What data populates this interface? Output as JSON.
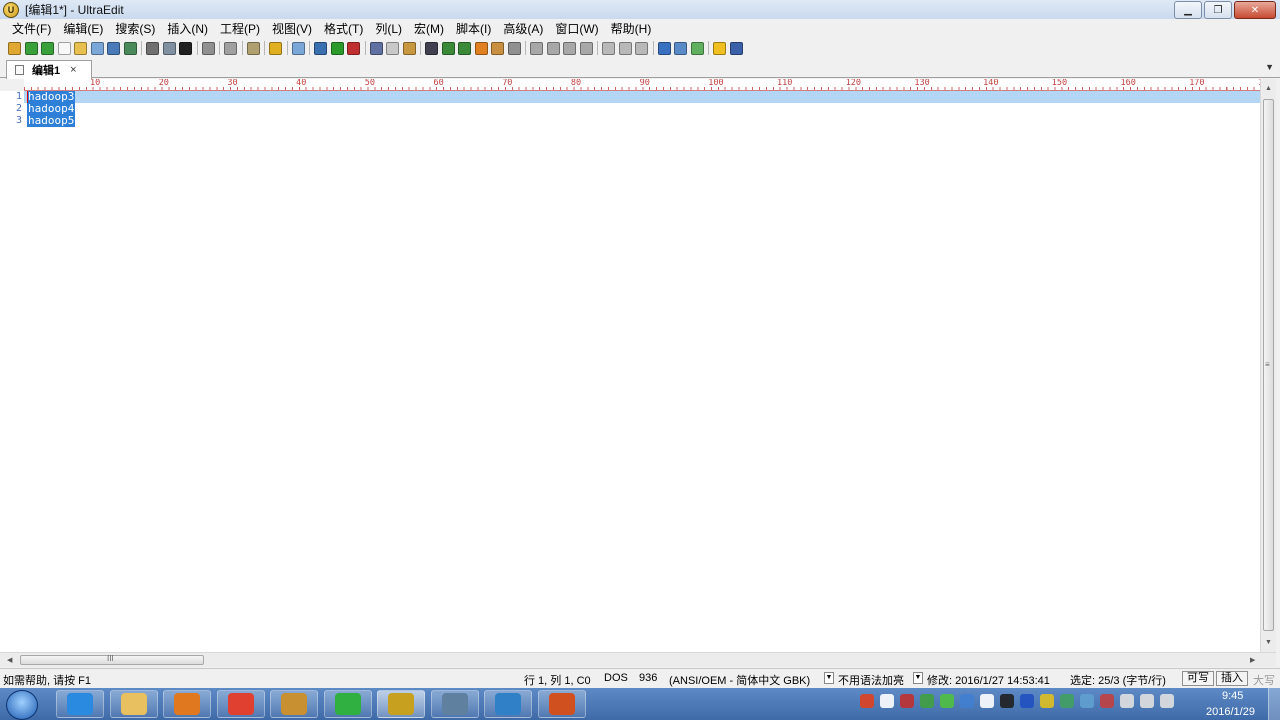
{
  "window": {
    "title": "[编辑1*] - UltraEdit",
    "min_glyph": "▁",
    "max_glyph": "❐",
    "close_glyph": "✕"
  },
  "menu": [
    "文件(F)",
    "编辑(E)",
    "搜索(S)",
    "插入(N)",
    "工程(P)",
    "视图(V)",
    "格式(T)",
    "列(L)",
    "宏(M)",
    "脚本(I)",
    "高级(A)",
    "窗口(W)",
    "帮助(H)"
  ],
  "toolbar": {
    "icons": [
      {
        "name": "new-project-icon",
        "color": "#e0a830"
      },
      {
        "name": "back-icon",
        "color": "#3aa03a"
      },
      {
        "name": "forward-icon",
        "color": "#3aa03a"
      },
      {
        "name": "new-file-icon",
        "color": "#f8f8f8"
      },
      {
        "name": "open-file-icon",
        "color": "#e8c050"
      },
      {
        "name": "close-file-icon",
        "color": "#7aa6d8"
      },
      {
        "name": "save-icon",
        "color": "#4a7bb8"
      },
      {
        "name": "save-all-icon",
        "color": "#4a8a5a"
      },
      {
        "name": "sep"
      },
      {
        "name": "print-icon",
        "color": "#707070"
      },
      {
        "name": "print-preview-icon",
        "color": "#8090a0"
      },
      {
        "name": "font-icon",
        "color": "#202020"
      },
      {
        "name": "sep"
      },
      {
        "name": "word-wrap-icon",
        "color": "#909090"
      },
      {
        "name": "sep"
      },
      {
        "name": "line-number-icon",
        "color": "#a0a0a0"
      },
      {
        "name": "sep"
      },
      {
        "name": "hex-icon",
        "color": "#b0a070"
      },
      {
        "name": "sep"
      },
      {
        "name": "column-icon",
        "color": "#e0b020"
      },
      {
        "name": "sep"
      },
      {
        "name": "spell-check-icon",
        "color": "#7aa6d8"
      },
      {
        "name": "sep"
      },
      {
        "name": "record-macro-icon",
        "color": "#3a6fb0"
      },
      {
        "name": "play-macro-icon",
        "color": "#2a9a2a"
      },
      {
        "name": "stop-macro-icon",
        "color": "#c03030"
      },
      {
        "name": "sep"
      },
      {
        "name": "cut-icon",
        "color": "#6070a0"
      },
      {
        "name": "copy-icon",
        "color": "#c8c8c8"
      },
      {
        "name": "paste-icon",
        "color": "#c89840"
      },
      {
        "name": "sep"
      },
      {
        "name": "find-icon",
        "color": "#404050"
      },
      {
        "name": "find-next-icon",
        "color": "#3a8a3a"
      },
      {
        "name": "find-prev-icon",
        "color": "#3a8a3a"
      },
      {
        "name": "replace-icon",
        "color": "#e08020"
      },
      {
        "name": "find-in-files-icon",
        "color": "#c89040"
      },
      {
        "name": "replace-in-files-icon",
        "color": "#909090"
      },
      {
        "name": "sep"
      },
      {
        "name": "align-left-icon",
        "color": "#a8a8a8"
      },
      {
        "name": "align-center-icon",
        "color": "#a8a8a8"
      },
      {
        "name": "align-right-icon",
        "color": "#a8a8a8"
      },
      {
        "name": "justify-icon",
        "color": "#a8a8a8"
      },
      {
        "name": "sep"
      },
      {
        "name": "split-horizontal-icon",
        "color": "#b8b8b8"
      },
      {
        "name": "split-vertical-icon",
        "color": "#b8b8b8"
      },
      {
        "name": "window-list-icon",
        "color": "#b8b8b8"
      },
      {
        "name": "sep"
      },
      {
        "name": "web-browser-icon",
        "color": "#3a70c0"
      },
      {
        "name": "ftp-icon",
        "color": "#5a8ac8"
      },
      {
        "name": "compare-icon",
        "color": "#60b060"
      },
      {
        "name": "sep"
      },
      {
        "name": "tip-icon",
        "color": "#f0c020"
      },
      {
        "name": "help-icon",
        "color": "#3a60a8"
      }
    ]
  },
  "tab": {
    "label": "编辑1",
    "close_glyph": "×",
    "menu_glyph": "▼"
  },
  "ruler": {
    "labels": [
      "10",
      "20",
      "30",
      "40",
      "50",
      "60",
      "70",
      "80",
      "90",
      "100",
      "110",
      "120",
      "130",
      "140",
      "150",
      "160",
      "170",
      "1"
    ]
  },
  "editor": {
    "lines": [
      {
        "no": "1",
        "text": "hadoop3"
      },
      {
        "no": "2",
        "text": "hadoop4"
      },
      {
        "no": "3",
        "text": "hadoop5"
      }
    ]
  },
  "scroll": {
    "up": "▲",
    "down": "▼",
    "left": "◀",
    "right": "▶",
    "grip": "≡",
    "hgrip": "III"
  },
  "status": {
    "help": "如需帮助, 请按 F1",
    "position": "行 1, 列 1, C0",
    "line_ending": "DOS",
    "codepage": "936",
    "encoding": "(ANSI/OEM - 简体中文 GBK)",
    "dropdown_glyph": "▼",
    "highlight": "不用语法加亮",
    "modified": "修改: 2016/1/27 14:53:41",
    "selection": "选定: 25/3 (字节/行)",
    "writable": "可写",
    "insert_mode": "插入",
    "caps": "大写"
  },
  "taskbar": {
    "apps": [
      {
        "name": "ie-icon",
        "color": "#2a8ae0"
      },
      {
        "name": "explorer-icon",
        "color": "#e8c060"
      },
      {
        "name": "media-player-icon",
        "color": "#e07820"
      },
      {
        "name": "chrome-icon",
        "color": "#e04030"
      },
      {
        "name": "installer-icon",
        "color": "#c89030"
      },
      {
        "name": "360-browser-icon",
        "color": "#30b040"
      },
      {
        "name": "ultraedit-icon",
        "color": "#c8a020"
      },
      {
        "name": "printer-icon",
        "color": "#6080a0"
      },
      {
        "name": "vmware-icon",
        "color": "#3080c8"
      },
      {
        "name": "game-icon",
        "color": "#d05020"
      }
    ],
    "tray": [
      {
        "name": "sogou-icon",
        "color": "#e04020"
      },
      {
        "name": "ime-icon",
        "color": "#ffffff"
      },
      {
        "name": "tray-app-icon",
        "color": "#c03030"
      },
      {
        "name": "network-icon",
        "color": "#40a040"
      },
      {
        "name": "wechat-icon",
        "color": "#50c040"
      },
      {
        "name": "shield-icon",
        "color": "#4080d0"
      },
      {
        "name": "windows-icon",
        "color": "#ffffff"
      },
      {
        "name": "qq-icon",
        "color": "#202020"
      },
      {
        "name": "bluetooth-icon",
        "color": "#2050c0"
      },
      {
        "name": "plus-icon",
        "color": "#e0c020"
      },
      {
        "name": "security-icon",
        "color": "#40a060"
      },
      {
        "name": "monitor-icon",
        "color": "#60a0d0"
      },
      {
        "name": "flag-icon",
        "color": "#c04040"
      },
      {
        "name": "usb-icon",
        "color": "#e0e0e0"
      },
      {
        "name": "volume-icon",
        "color": "#e0e0e0"
      },
      {
        "name": "signal-icon",
        "color": "#e0e0e0"
      }
    ],
    "time": "9:45",
    "date": "2016/1/29"
  }
}
